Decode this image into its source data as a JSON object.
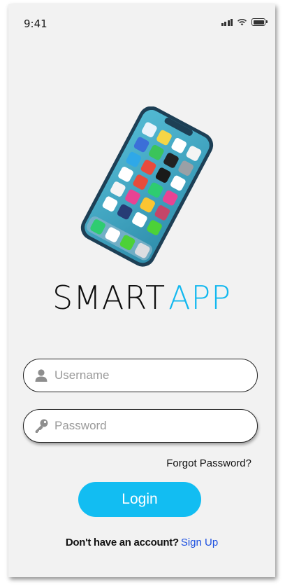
{
  "status_bar": {
    "time": "9:41"
  },
  "branding": {
    "name_part1": "SMART",
    "name_part2": "APP"
  },
  "form": {
    "username_placeholder": "Username",
    "password_placeholder": "Password",
    "forgot_password": "Forgot Password?",
    "login_label": "Login"
  },
  "footer": {
    "prompt": "Don't have an account?",
    "signup_label": "Sign Up"
  },
  "colors": {
    "accent": "#12bdf2",
    "link": "#1b4fe0",
    "background": "#f2f2f2"
  },
  "icons": {
    "username": "user-icon",
    "password": "key-icon"
  }
}
